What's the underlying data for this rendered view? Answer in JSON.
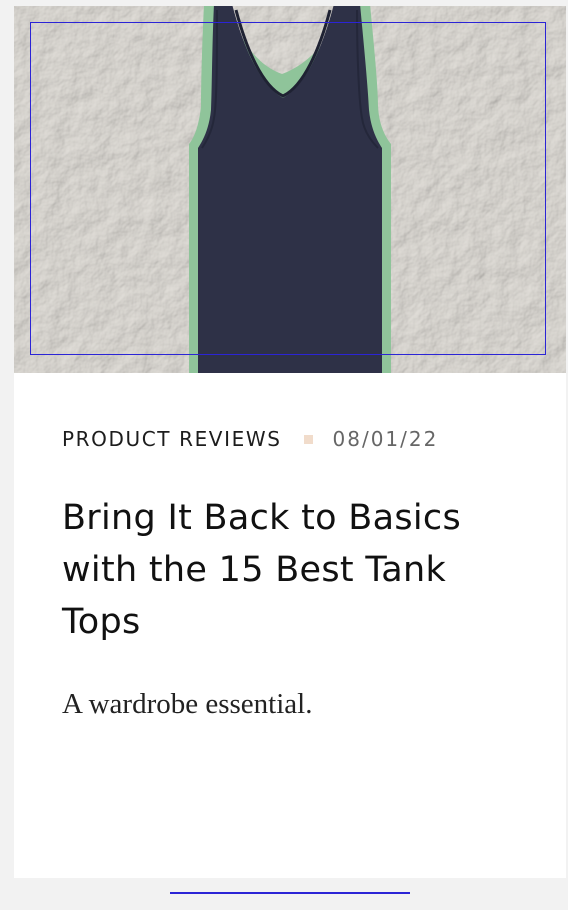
{
  "article": {
    "category": "PRODUCT REVIEWS",
    "date": "08/01/22",
    "title": "Bring It Back to Basics with the 15 Best Tank Tops",
    "deck": "A wardrobe essential."
  },
  "image": {
    "icon": "tank-top-image",
    "colors": {
      "background": "#d9d6d0",
      "garment": "#2e3147",
      "outline": "#8fc49a",
      "focus": "#2b24d6",
      "separator": "#f1dccb"
    }
  }
}
